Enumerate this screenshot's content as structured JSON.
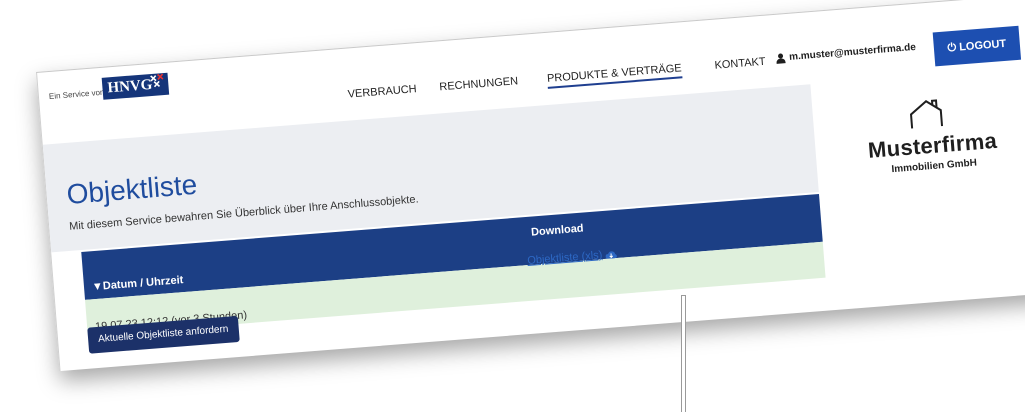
{
  "header": {
    "service_text": "Ein Service von",
    "brand": "HNVG",
    "nav": {
      "verbrauch": "VERBRAUCH",
      "rechnungen": "RECHNUNGEN",
      "produkte": "PRODUKTE & VERTRÄGE",
      "kontakt": "KONTAKT"
    },
    "user_email": "m.muster@musterfirma.de",
    "logout_label": "LOGOUT"
  },
  "page": {
    "title": "Objektliste",
    "subtitle": "Mit diesem Service bewahren Sie Überblick über Ihre Anschlussobjekte."
  },
  "company": {
    "name": "Musterfirma",
    "sub": "Immobilien GmbH"
  },
  "table": {
    "col_date": "▼Datum / Uhrzeit",
    "col_download": "Download",
    "rows": [
      {
        "date": "19.07.23 12:12 (vor 3 Stunden)",
        "download": "Objektliste (xls)"
      }
    ]
  },
  "request_button": "Aktuelle Objektliste anfordern",
  "colors": {
    "brand": "#15357a",
    "accent": "#1d4fb1",
    "table_header": "#1c3f85",
    "row_bg": "#dff0dc",
    "link": "#2d68c4"
  }
}
